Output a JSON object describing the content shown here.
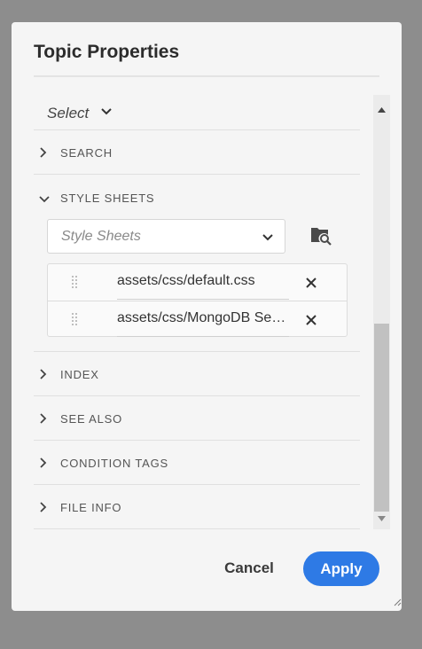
{
  "dialog": {
    "title": "Topic Properties"
  },
  "select": {
    "label": "Select"
  },
  "sections": {
    "search": "SEARCH",
    "style_sheets": "STYLE SHEETS",
    "index": "INDEX",
    "see_also": "SEE ALSO",
    "condition_tags": "CONDITION TAGS",
    "file_info": "FILE INFO"
  },
  "style_sheets": {
    "placeholder": "Style Sheets",
    "browse_icon": "folder-search-icon",
    "items": [
      {
        "path": "assets/css/default.css"
      },
      {
        "path": "assets/css/MongoDB Server"
      }
    ]
  },
  "buttons": {
    "cancel": "Cancel",
    "apply": "Apply"
  },
  "colors": {
    "accent": "#2e7ae5",
    "backdrop": "#8d8d8d",
    "dialog_bg": "#f5f5f5"
  }
}
